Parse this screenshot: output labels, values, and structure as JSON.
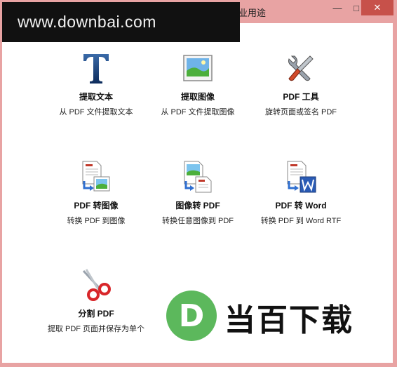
{
  "window": {
    "title_fragment": "业用途",
    "minimize_glyph": "—",
    "maximize_glyph": "□",
    "close_glyph": "✕"
  },
  "watermark": {
    "text": "www.downbai.com"
  },
  "tiles": [
    {
      "title": "提取文本",
      "desc": "从 PDF 文件提取文本",
      "icon": "letter-t-icon"
    },
    {
      "title": "提取图像",
      "desc": "从 PDF 文件提取图像",
      "icon": "picture-icon"
    },
    {
      "title": "PDF 工具",
      "desc": "旋转页面或签名 PDF",
      "icon": "tools-icon"
    },
    {
      "title": "PDF 转图像",
      "desc": "转换 PDF 到图像",
      "icon": "pdf-to-image-icon"
    },
    {
      "title": "图像转 PDF",
      "desc": "转换任意图像到 PDF",
      "icon": "image-to-pdf-icon"
    },
    {
      "title": "PDF 转 Word",
      "desc": "转换 PDF 到 Word RTF",
      "icon": "pdf-to-word-icon"
    },
    {
      "title": "分割 PDF",
      "desc": "提取 PDF 页面并保存为单个",
      "icon": "scissors-icon"
    }
  ],
  "brand": {
    "text": "当百下载",
    "logo_letter": "D"
  },
  "colors": {
    "frame": "#e8a3a3",
    "close_button": "#c7514a",
    "watermark_bg": "#111111",
    "brand_green": "#5cb85c"
  }
}
